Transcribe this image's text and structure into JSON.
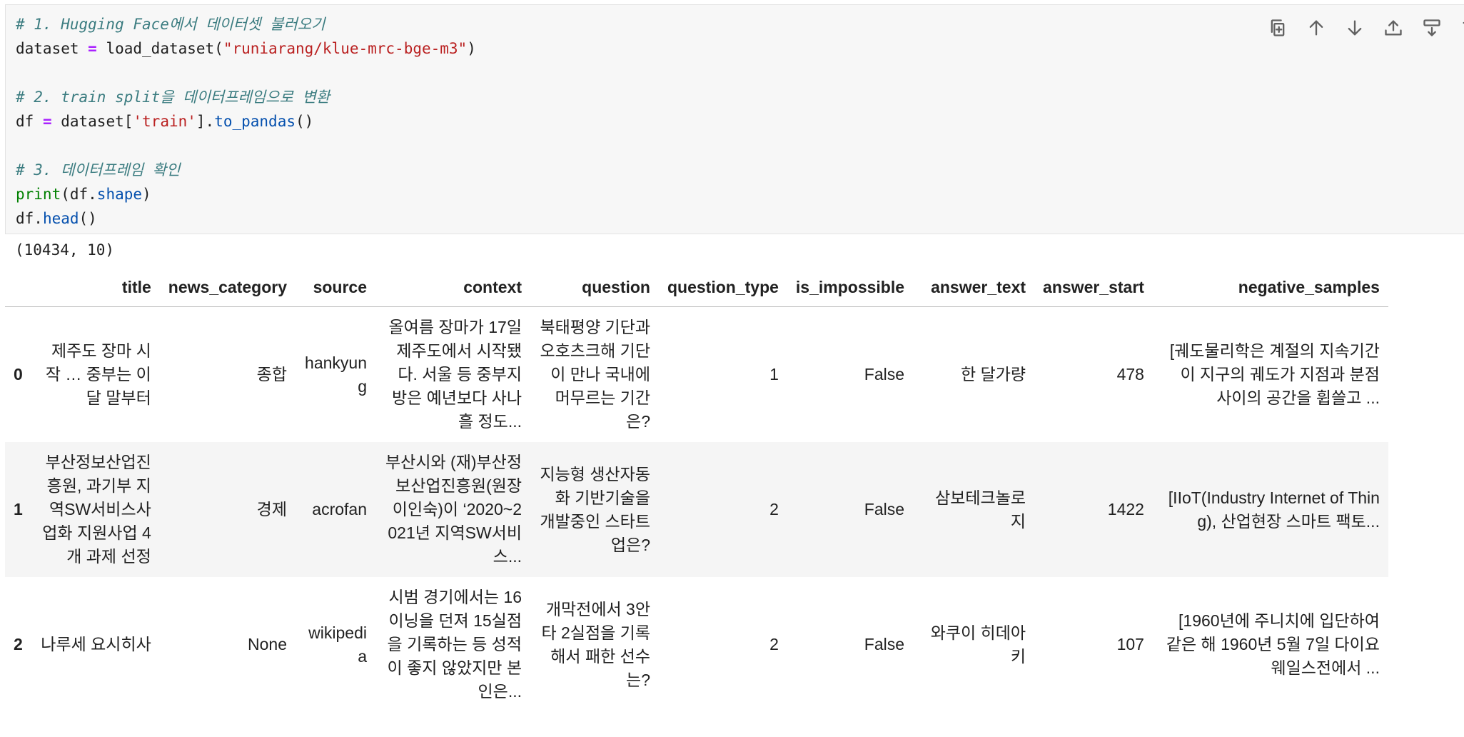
{
  "code_cell": {
    "lines": [
      [
        {
          "t": "# 1. Hugging Face에서 데이터셋 불러오기",
          "c": "cm"
        }
      ],
      [
        {
          "t": "dataset ",
          "c": ""
        },
        {
          "t": "=",
          "c": "op"
        },
        {
          "t": " load_dataset(",
          "c": ""
        },
        {
          "t": "\"runiarang/klue-mrc-bge-m3\"",
          "c": "st"
        },
        {
          "t": ")",
          "c": ""
        }
      ],
      [],
      [
        {
          "t": "# 2. train split을 데이터프레임으로 변환",
          "c": "cm"
        }
      ],
      [
        {
          "t": "df ",
          "c": ""
        },
        {
          "t": "=",
          "c": "op"
        },
        {
          "t": " dataset[",
          "c": ""
        },
        {
          "t": "'train'",
          "c": "st"
        },
        {
          "t": "].",
          "c": ""
        },
        {
          "t": "to_pandas",
          "c": "mt"
        },
        {
          "t": "()",
          "c": ""
        }
      ],
      [],
      [
        {
          "t": "# 3. 데이터프레임 확인",
          "c": "cm"
        }
      ],
      [
        {
          "t": "print",
          "c": "bi"
        },
        {
          "t": "(df.",
          "c": ""
        },
        {
          "t": "shape",
          "c": "mt"
        },
        {
          "t": ")",
          "c": ""
        }
      ],
      [
        {
          "t": "df.",
          "c": ""
        },
        {
          "t": "head",
          "c": "mt"
        },
        {
          "t": "()",
          "c": ""
        }
      ]
    ]
  },
  "toolbar": {
    "buttons": [
      {
        "name": "copy-cell-icon"
      },
      {
        "name": "move-up-icon"
      },
      {
        "name": "move-down-icon"
      },
      {
        "name": "insert-above-icon"
      },
      {
        "name": "insert-below-icon"
      },
      {
        "name": "delete-icon"
      }
    ]
  },
  "output": {
    "shape": "(10434, 10)",
    "dataframe": {
      "columns": [
        "",
        "title",
        "news_category",
        "source",
        "context",
        "question",
        "question_type",
        "is_impossible",
        "answer_text",
        "answer_start",
        "negative_samples"
      ],
      "rows": [
        [
          "0",
          "제주도 장마 시작 … 중부는 이달 말부터",
          "종합",
          "hankyung",
          "올여름 장마가 17일 제주도에서 시작됐다. 서울 등 중부지방은 예년보다 사나흘 정도...",
          "북태평양 기단과 오호츠크해 기단이 만나 국내에 머무르는 기간은?",
          "1",
          "False",
          "한 달가량",
          "478",
          "[궤도물리학은 계절의 지속기간이 지구의 궤도가 지점과 분점 사이의 공간을 휩쓸고 ..."
        ],
        [
          "1",
          "부산정보산업진흥원, 과기부 지역SW서비스사업화 지원사업 4개 과제 선정",
          "경제",
          "acrofan",
          "부산시와 (재)부산정보산업진흥원(원장 이인숙)이 ‘2020~2021년 지역SW서비스...",
          "지능형 생산자동화 기반기술을 개발중인 스타트업은?",
          "2",
          "False",
          "삼보테크놀로지",
          "1422",
          "[IIoT(Industry Internet of Thing), 산업현장 스마트 팩토..."
        ],
        [
          "2",
          "나루세 요시히사",
          "None",
          "wikipedia",
          "시범 경기에서는 16이닝을 던져 15실점을 기록하는 등 성적이 좋지 않았지만 본인은...",
          "개막전에서 3안타 2실점을 기록해서 패한 선수는?",
          "2",
          "False",
          "와쿠이 히데아키",
          "107",
          "[1960년에 주니치에 입단하여 같은 해 1960년 5월 7일 다이요 웨일스전에서 ..."
        ]
      ]
    }
  }
}
